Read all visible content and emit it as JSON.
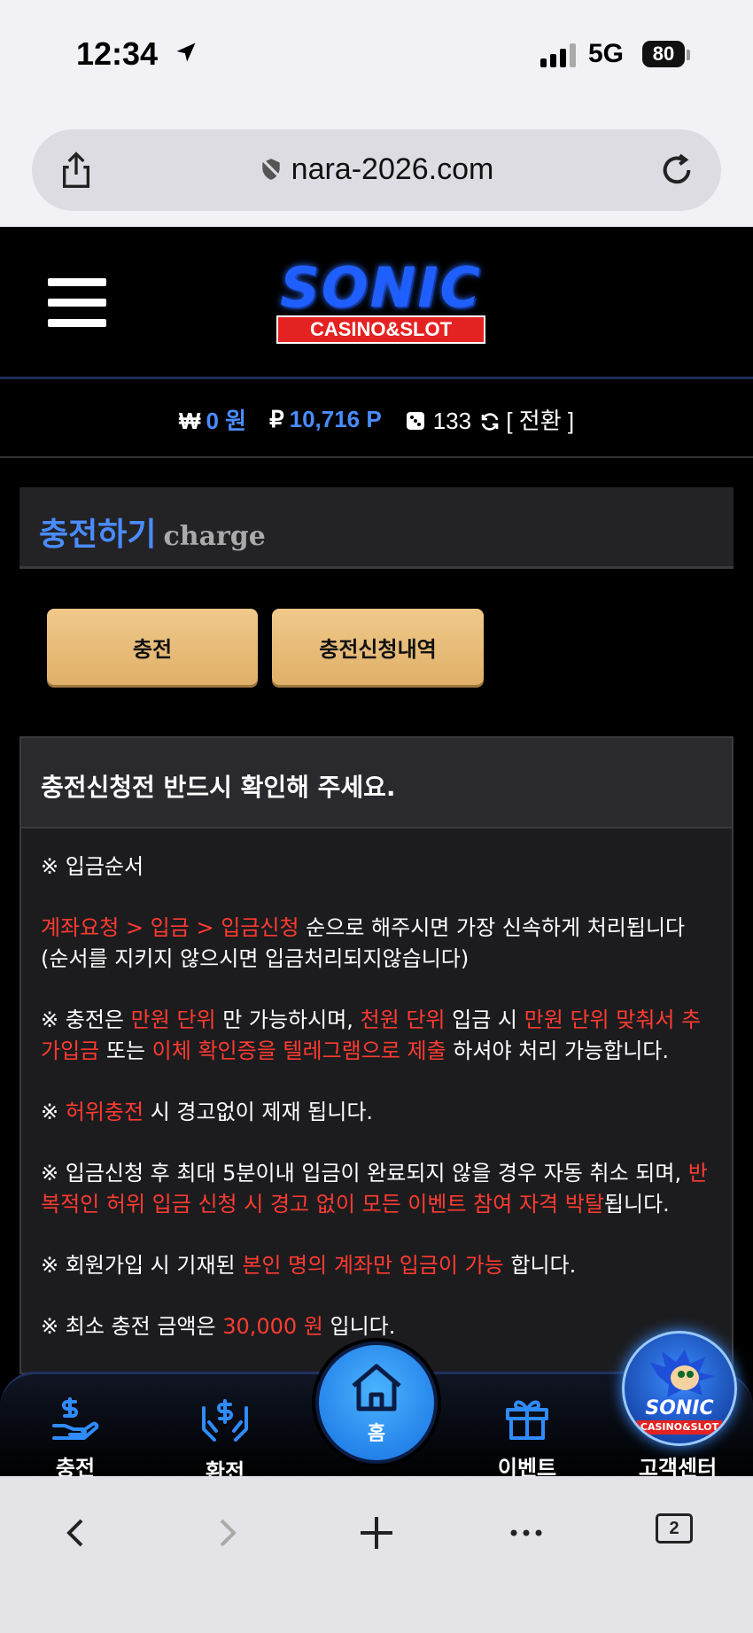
{
  "status": {
    "time": "12:34",
    "network": "5G",
    "battery": "80"
  },
  "browser": {
    "url": "nara-2026.com",
    "tab_count": "2"
  },
  "logo": {
    "title": "SONIC",
    "tagline": "CASINO&SLOT"
  },
  "balance": {
    "won_symbol": "₩",
    "won_value": "0 원",
    "point_symbol": "₽",
    "point_value": "10,716 P",
    "dice_value": "133",
    "switch_label": "[ 전환 ]"
  },
  "page": {
    "title_ko": "충전하기",
    "title_en": "charge"
  },
  "buttons": {
    "charge": "충전",
    "history": "충전신청내역"
  },
  "notice": {
    "heading": "충전신청전 반드시 확인해 주세요.",
    "p1": "※ 입금순서",
    "p2_red": "계좌요청 > 입금 > 입금신청",
    "p2_rest": " 순으로 해주시면 가장 신속하게 처리됩니다 (순서를 지키지 않으시면 입금처리되지않습니다)",
    "p3_a": "※ 충전은 ",
    "p3_b_red": "만원 단위",
    "p3_c": " 만 가능하시며, ",
    "p3_d_red": "천원 단위",
    "p3_e": " 입금 시 ",
    "p3_f_red": "만원 단위 맞춰서 추가입금",
    "p3_g": " 또는 ",
    "p3_h_red": "이체 확인증을 텔레그램으로 제출",
    "p3_i": " 하셔야 처리 가능합니다.",
    "p4_a": "※ ",
    "p4_b_red": "허위충전",
    "p4_c": " 시 경고없이 제재 됩니다.",
    "p5_a": "※ 입금신청 후 최대 5분이내 입금이 완료되지 않을 경우 자동 취소 되며, ",
    "p5_b_red": "반복적인 허위 입금 신청 시 경고 없이 모든 이벤트 참여 자격 박탈",
    "p5_c": "됩니다.",
    "p6_a": "※ 회원가입 시 기재된 ",
    "p6_b_red": "본인 명의 계좌만 입금이 가능",
    "p6_c": " 합니다.",
    "p7_a": "※ 최소 충전 금액은 ",
    "p7_b_red": "30,000 원",
    "p7_c": " 입니다."
  },
  "nav": {
    "charge": "충전",
    "exchange": "환전",
    "home": "홈",
    "event": "이벤트",
    "support": "고객센터",
    "badge_title": "SONIC",
    "badge_tag": "CASINO&SLOT"
  },
  "colors": {
    "accent_blue": "#4a8cff",
    "warning_red": "#ff3b30",
    "button_gold": "#e8bd78"
  }
}
